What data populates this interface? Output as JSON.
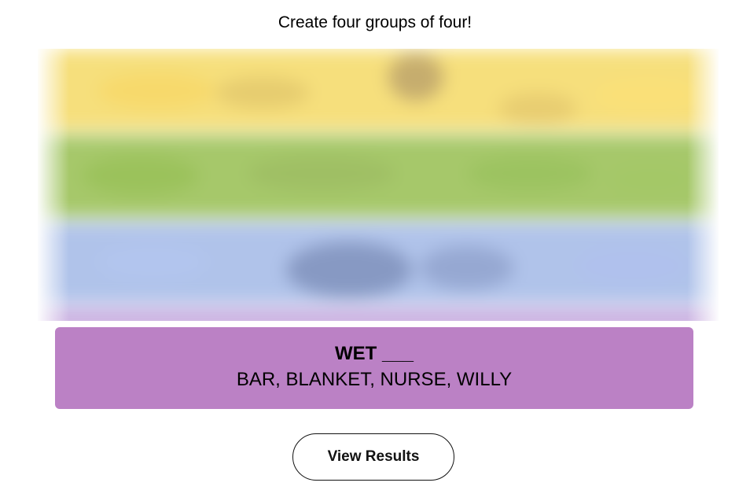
{
  "instructions": "Create four groups of four!",
  "board": {
    "state": "hidden",
    "colors": {
      "yellow": "#f6df7c",
      "green": "#a6c86a",
      "blue": "#b0c3ea",
      "purple": "#c9aee0"
    }
  },
  "solved_group": {
    "title": "WET ___",
    "members": "BAR, BLANKET, NURSE, WILLY",
    "color": "#bb81c5"
  },
  "actions": {
    "view_results_label": "View Results"
  }
}
